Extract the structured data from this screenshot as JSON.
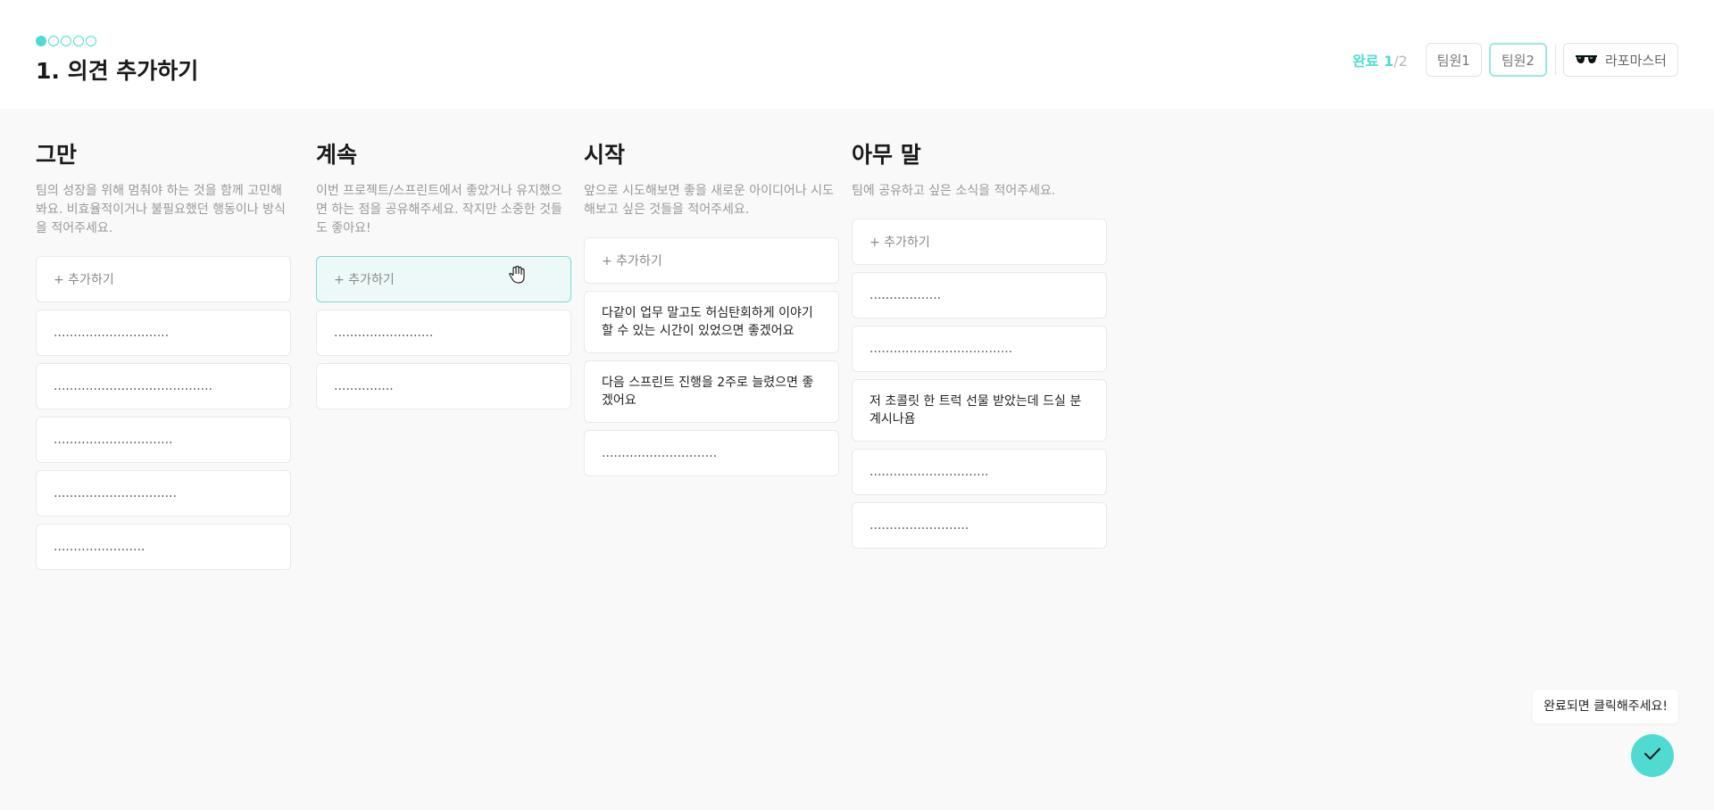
{
  "header": {
    "steps": [
      true,
      false,
      false,
      false,
      false
    ],
    "title": "1. 의견 추가하기",
    "progress_done": "완료 1",
    "progress_total": "/2",
    "members": [
      {
        "label": "팀원1",
        "selected": false
      },
      {
        "label": "팀원2",
        "selected": true
      }
    ],
    "user": {
      "icon": "sunglasses-icon",
      "name": "라포마스터"
    }
  },
  "columns": [
    {
      "title": "그만",
      "description": "팀의 성장을 위해 멈춰야 하는 것을 함께 고민해봐요. 비효율적이거나 불필요했던 행동이나 방식을 적어주세요.",
      "add_label": "+ 추가하기",
      "cards": [
        ".............................",
        "........................................",
        "..............................",
        "...............................",
        "......................."
      ]
    },
    {
      "title": "계속",
      "description": "이번 프로젝트/스프린트에서 좋았거나 유지했으면 하는 점을 공유해주세요. 작지만 소중한 것들도 좋아요!",
      "add_label": "+ 추가하기",
      "cards": [
        ".........................",
        "..............."
      ]
    },
    {
      "title": "시작",
      "description": "앞으로 시도해보면 좋을 새로운 아이디어나 시도해보고 싶은 것들을 적어주세요.",
      "add_label": "+ 추가하기",
      "cards": [
        "다같이 업무 말고도 허심탄회하게 이야기할 수 있는 시간이 있었으면 좋겠어요",
        "다음 스프린트 진행을 2주로 늘렸으면 좋겠어요",
        "............................."
      ]
    },
    {
      "title": "아무 말",
      "description": "팀에 공유하고 싶은 소식을 적어주세요.",
      "add_label": "+ 추가하기",
      "cards": [
        "..................",
        "....................................",
        "저 초콜릿 한 트럭 선물 받았는데 드실 분 계시나욤",
        "..............................",
        "........................."
      ]
    }
  ],
  "footer": {
    "tooltip": "완료되면 클릭해주세요!",
    "done_icon": "check-icon"
  },
  "colors": {
    "accent": "#4fdbd1",
    "hover_bg": "#edf9f8"
  }
}
